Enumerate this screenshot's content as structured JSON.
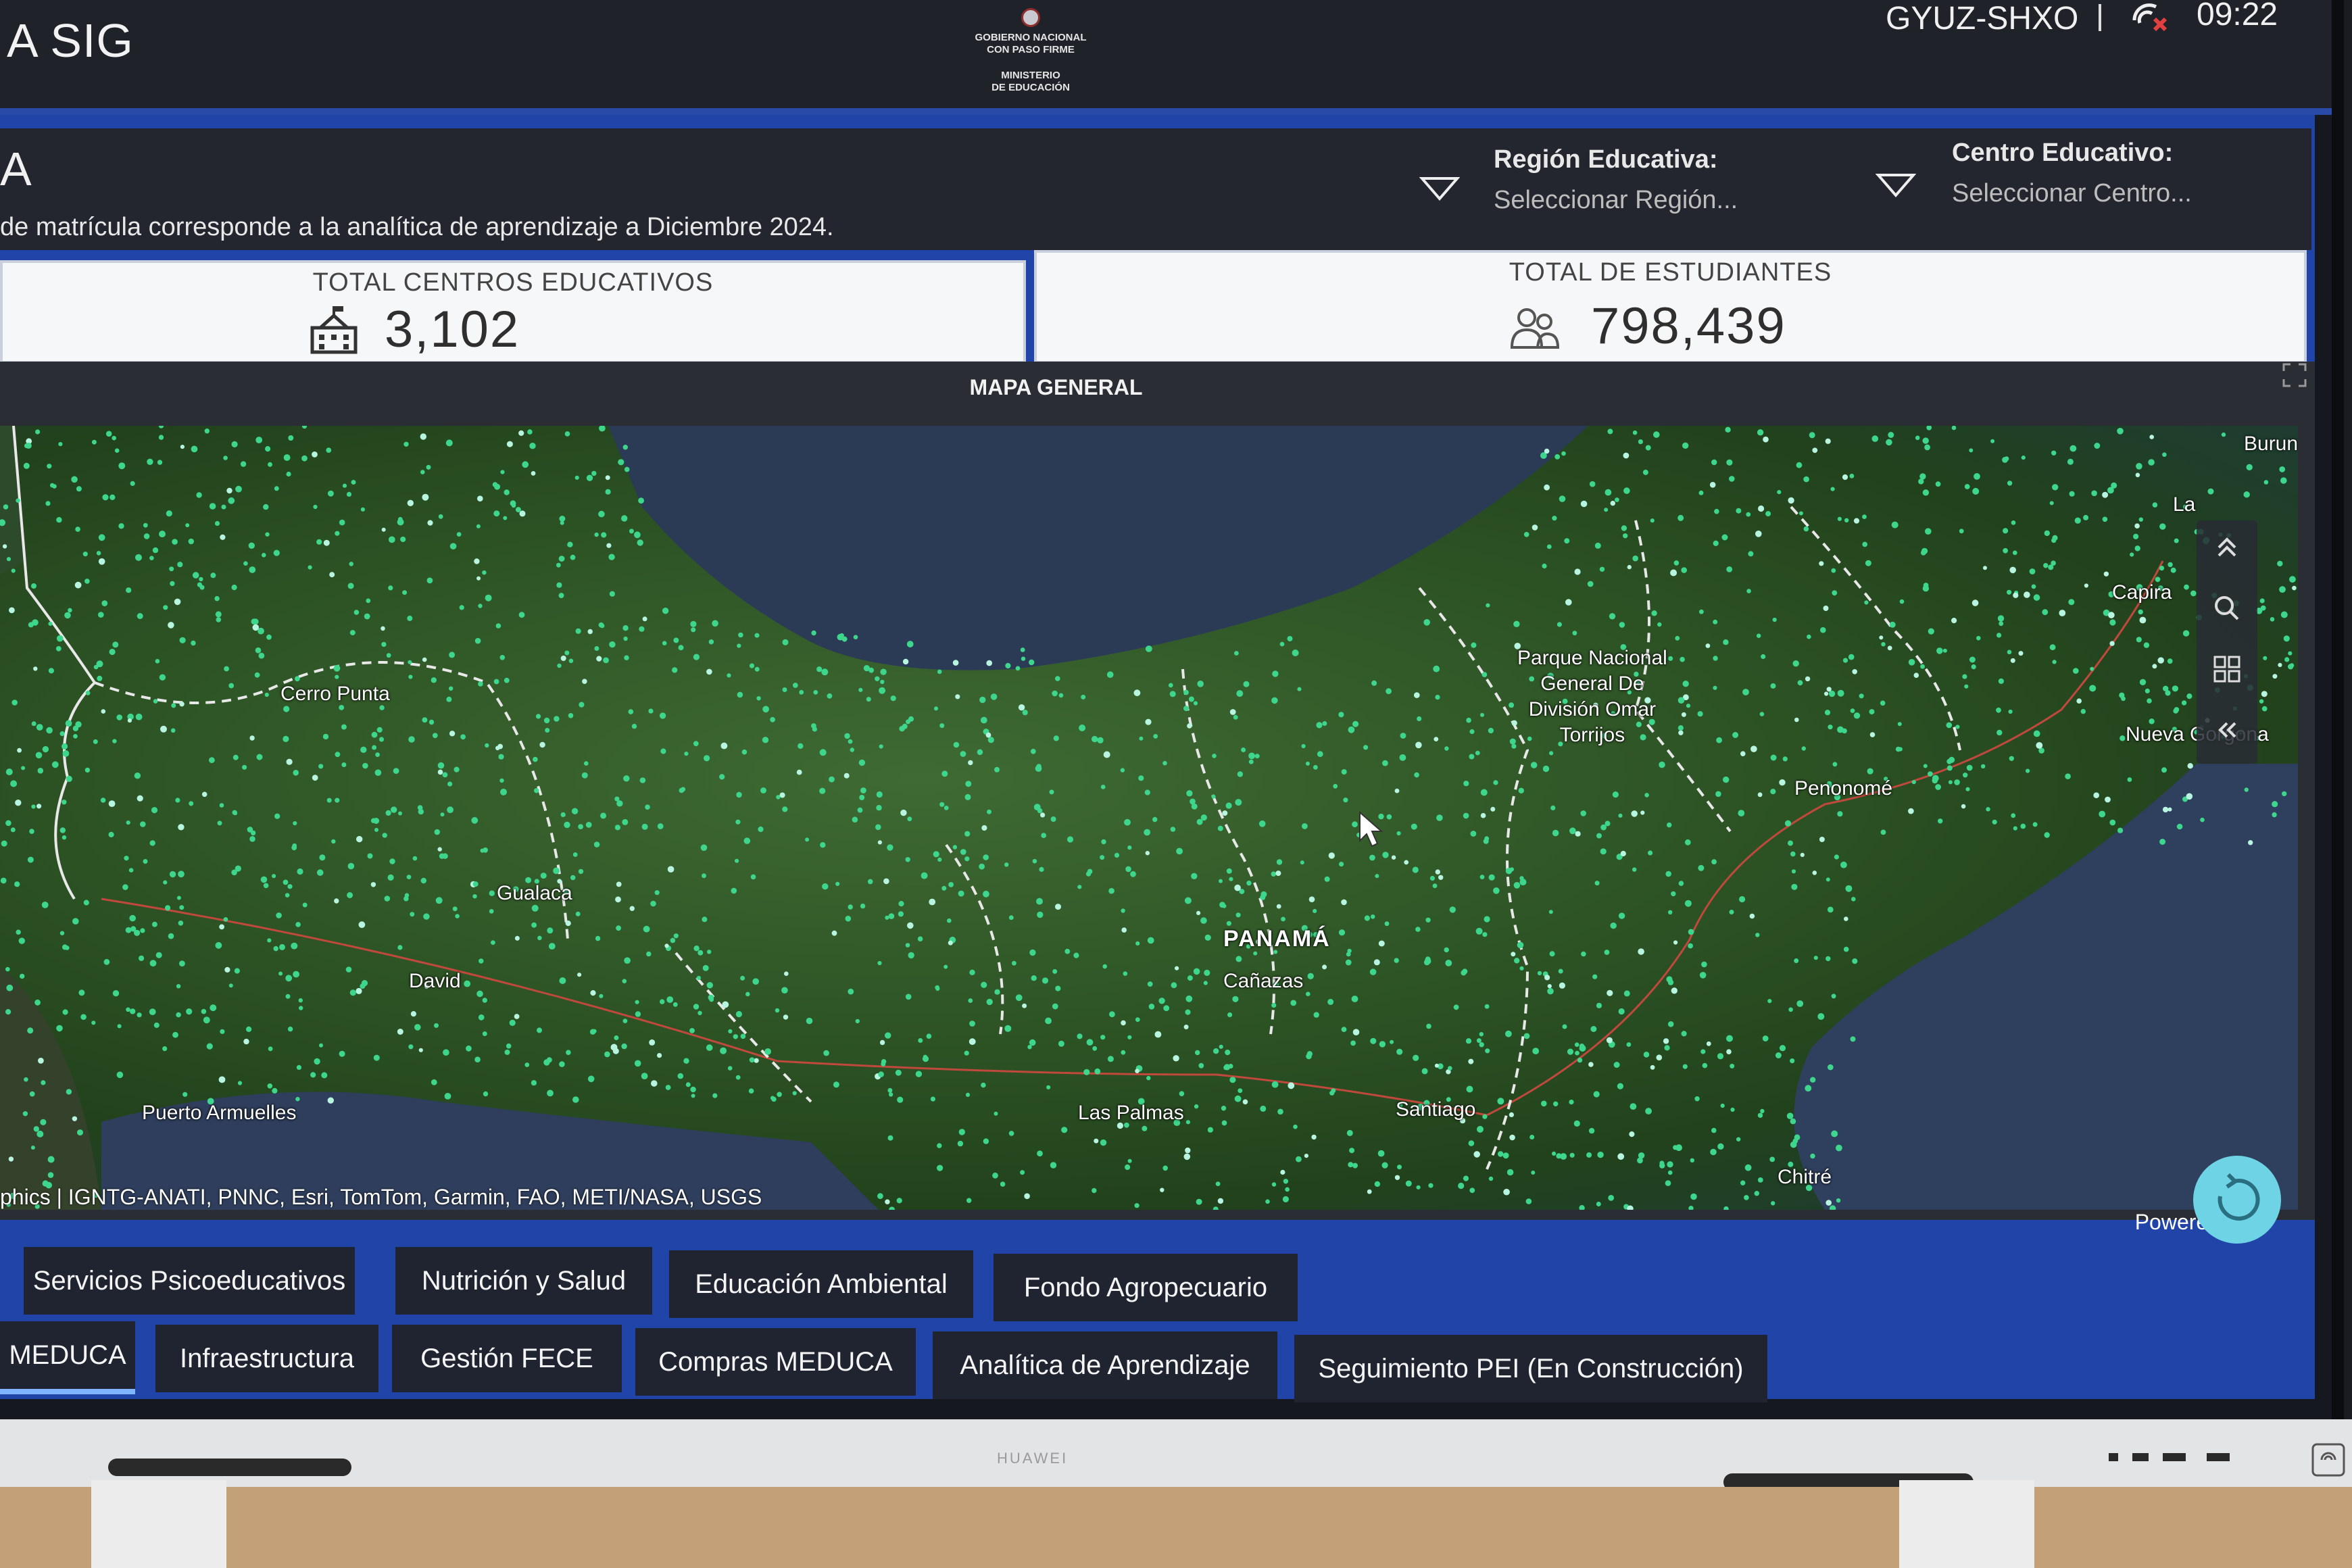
{
  "topbar": {
    "app_title": "A SIG",
    "logo_line1": "GOBIERNO NACIONAL",
    "logo_line2": "CON PASO FIRME",
    "logo_line3": "MINISTERIO",
    "logo_line4": "DE EDUCACIÓN",
    "user_code": "GYUZ-SHXO",
    "time": "09:22"
  },
  "header": {
    "title_fragment": "A",
    "subtitle": "de matrícula corresponde a la analítica de aprendizaje a Diciembre 2024.",
    "filters": [
      {
        "label": "Región Educativa:",
        "placeholder": "Seleccionar Región..."
      },
      {
        "label": "Centro Educativo:",
        "placeholder": "Seleccionar Centro..."
      }
    ]
  },
  "kpis": [
    {
      "label": "TOTAL CENTROS EDUCATIVOS",
      "value": "3,102",
      "icon": "school-building-icon"
    },
    {
      "label": "TOTAL DE ESTUDIANTES",
      "value": "798,439",
      "icon": "students-group-icon"
    }
  ],
  "map": {
    "title": "MAPA GENERAL",
    "labels": {
      "cerro_punta": "Cerro Punta",
      "gualaca": "Gualaca",
      "david": "David",
      "puerto_armuelles": "Puerto Armuelles",
      "panama": "PANAMÁ",
      "canazas": "Cañazas",
      "las_palmas": "Las Palmas",
      "santiago": "Santiago",
      "chitre": "Chitré",
      "penonome": "Penonomé",
      "nueva_gorgona": "Nueva Gorgona",
      "capira": "Capira",
      "burun": "Burun",
      "la": "La",
      "parque_l1": "Parque Nacional",
      "parque_l2": "General De",
      "parque_l3": "División Omar",
      "parque_l4": "Torrijos"
    },
    "attribution": "phics | IGNTG-ANATI, PNNC, Esri, TomTom, Garmin, FAO, METI/NASA, USGS",
    "powered_by": "Powered"
  },
  "tabs_row1": [
    "Servicios Psicoeducativos",
    "Nutrición y Salud",
    "Educación Ambiental",
    "Fondo Agropecuario"
  ],
  "tabs_row2": [
    "MEDUCA",
    "Infraestructura",
    "Gestión FECE",
    "Compras MEDUCA",
    "Analítica de Aprendizaje",
    "Seguimiento PEI (En Construcción)"
  ],
  "device": {
    "brand": "HUAWEI"
  },
  "colors": {
    "accent": "#2144a8",
    "school_dot": "#3dd68c",
    "refresh": "#6fd3e6"
  }
}
